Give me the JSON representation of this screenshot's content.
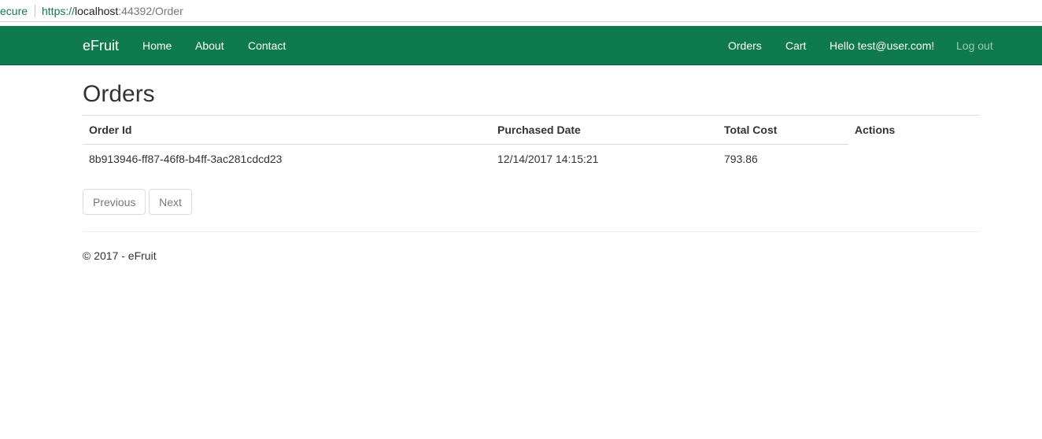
{
  "browser": {
    "security_label": "ecure",
    "url_scheme": "https://",
    "url_host": "localhost",
    "url_rest": ":44392/Order"
  },
  "navbar": {
    "brand": "eFruit",
    "left_links": [
      "Home",
      "About",
      "Contact"
    ],
    "right_links": [
      "Orders",
      "Cart",
      "Hello test@user.com!"
    ],
    "logout": "Log out",
    "background_color": "#0f7a4d"
  },
  "page": {
    "title": "Orders"
  },
  "table": {
    "headers": {
      "order_id": "Order Id",
      "purchased_date": "Purchased Date",
      "total_cost": "Total Cost",
      "actions": "Actions"
    },
    "rows": [
      {
        "order_id": "8b913946-ff87-46f8-b4ff-3ac281cdcd23",
        "purchased_date": "12/14/2017 14:15:21",
        "total_cost": "793.86"
      }
    ]
  },
  "pager": {
    "previous": "Previous",
    "next": "Next"
  },
  "footer": {
    "text": "© 2017 - eFruit"
  }
}
